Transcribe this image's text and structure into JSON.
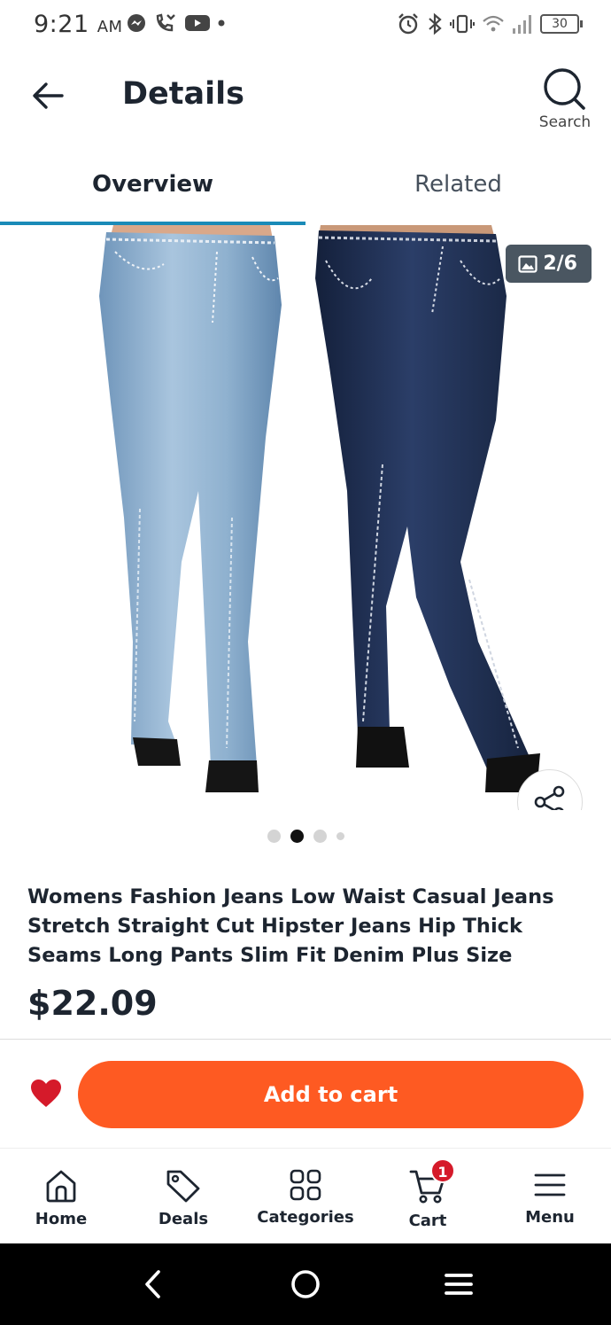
{
  "status_bar": {
    "time": "9:21",
    "ampm": "AM",
    "battery": "30"
  },
  "header": {
    "title": "Details",
    "search_label": "Search"
  },
  "tabs": [
    {
      "label": "Overview",
      "active": true
    },
    {
      "label": "Related",
      "active": false
    }
  ],
  "gallery": {
    "counter": "2/6",
    "current_index": 2,
    "total_dots": 4
  },
  "product": {
    "title": "Womens Fashion Jeans Low Waist Casual Jeans Stretch Straight Cut Hipster Jeans Hip Thick Seams Long Pants Slim Fit Denim Plus Size",
    "price": "$22.09"
  },
  "actions": {
    "add_to_cart_label": "Add to cart"
  },
  "bottom_nav": [
    {
      "label": "Home",
      "icon": "home-icon"
    },
    {
      "label": "Deals",
      "icon": "tag-icon"
    },
    {
      "label": "Categories",
      "icon": "grid-icon"
    },
    {
      "label": "Cart",
      "icon": "cart-icon",
      "badge": "1"
    },
    {
      "label": "Menu",
      "icon": "hamburger-icon"
    }
  ],
  "colors": {
    "accent_orange": "#fe5a22",
    "tab_underline": "#1a8bb8",
    "heart_red": "#d51a2a",
    "light_jeans": "#8fb1cf",
    "dark_jeans": "#1e2d4f"
  }
}
